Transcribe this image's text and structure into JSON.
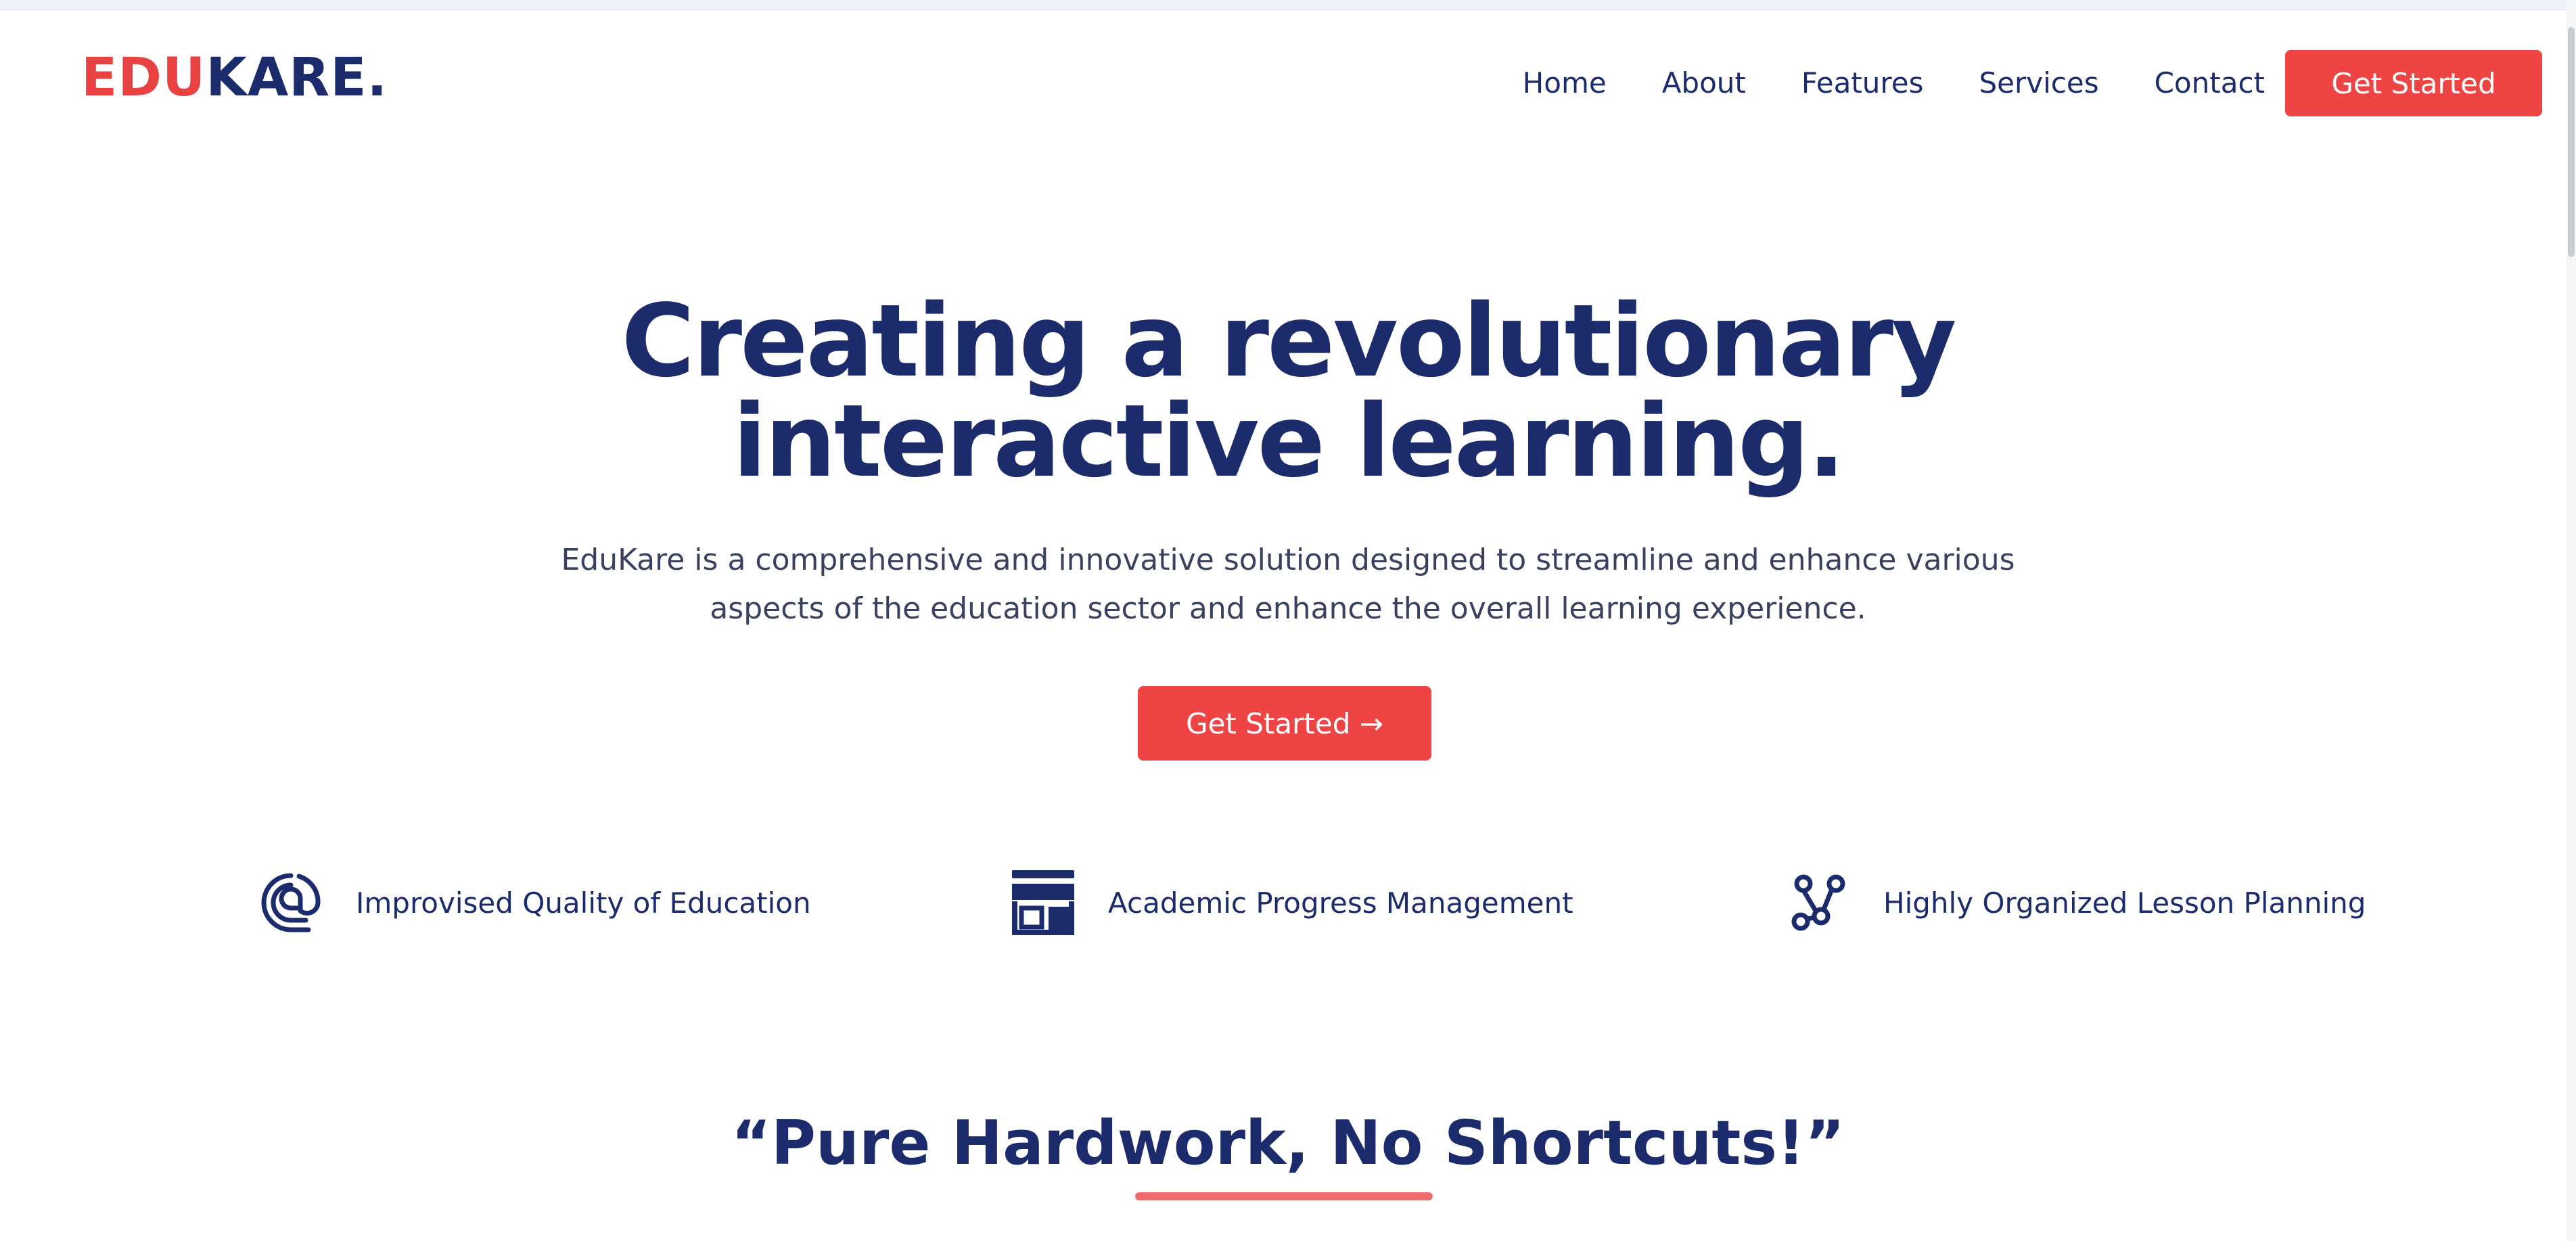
{
  "header": {
    "logo_part1": "EDU",
    "logo_part2": "KARE.",
    "nav": [
      {
        "label": "Home"
      },
      {
        "label": "About"
      },
      {
        "label": "Features"
      },
      {
        "label": "Services"
      },
      {
        "label": "Contact"
      }
    ],
    "cta_label": "Get Started"
  },
  "hero": {
    "title_line1": "Creating a revolutionary",
    "title_line2": "interactive learning.",
    "subtitle": "EduKare is a comprehensive and innovative solution designed to streamline and enhance various aspects of the education sector and enhance the overall learning experience.",
    "cta_label": "Get Started →"
  },
  "features": [
    {
      "icon": "at-sign-icon",
      "label": "Improvised Quality of Education"
    },
    {
      "icon": "store-icon",
      "label": "Academic Progress Management"
    },
    {
      "icon": "network-nodes-icon",
      "label": "Highly Organized Lesson Planning"
    }
  ],
  "quote": {
    "text": "“Pure Hardwork, No Shortcuts!”"
  },
  "colors": {
    "primary": "#1b2b6b",
    "accent": "#ef4444",
    "text_muted": "#3a4160",
    "background": "#ffffff"
  }
}
